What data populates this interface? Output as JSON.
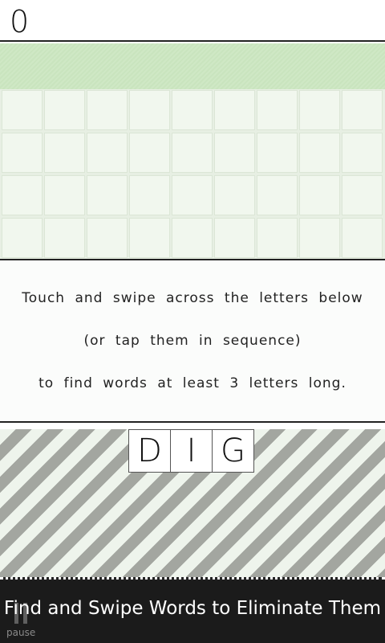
{
  "score": "0",
  "grid": {
    "rows": 4,
    "cols": 9
  },
  "instructions": [
    "Touch and swipe across the letters below",
    "(or tap them in sequence)",
    "to find words at least 3 letters long."
  ],
  "word_tiles": [
    "D",
    "I",
    "G"
  ],
  "pause_label": "pause",
  "banner_text": "Find and Swipe Words to Eliminate Them",
  "colors": {
    "accent_green": "#cfe8c5",
    "stripe_gray": "#a3a6a0",
    "bar_dark": "#1b1b1b"
  }
}
